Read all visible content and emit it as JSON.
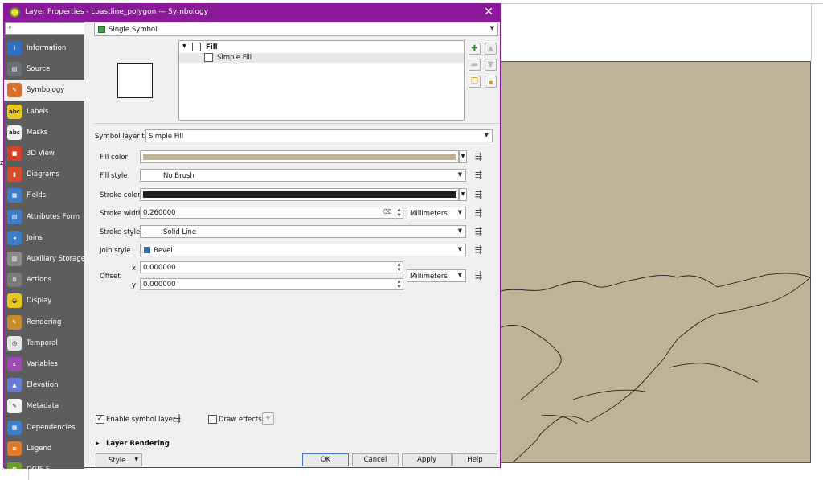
{
  "dialog": {
    "title": "Layer Properties - coastline_polygon — Symbology"
  },
  "sidebar": {
    "search_placeholder": "",
    "items": [
      {
        "label": "Information",
        "icon": "info-icon",
        "color": "#2f6fc2"
      },
      {
        "label": "Source",
        "icon": "source-icon",
        "color": "#6a6f74"
      },
      {
        "label": "Symbology",
        "icon": "paintbrush-icon",
        "color": "#d86f2a"
      },
      {
        "label": "Labels",
        "icon": "labels-icon",
        "color": "#e8c81a"
      },
      {
        "label": "Masks",
        "icon": "masks-icon",
        "color": "#f2f2f2"
      },
      {
        "label": "3D View",
        "icon": "cube-icon",
        "color": "#d8402a"
      },
      {
        "label": "Diagrams",
        "icon": "diagrams-icon",
        "color": "#d84a2a"
      },
      {
        "label": "Fields",
        "icon": "fields-icon",
        "color": "#3d7cc7"
      },
      {
        "label": "Attributes Form",
        "icon": "form-icon",
        "color": "#3d7cc7"
      },
      {
        "label": "Joins",
        "icon": "joins-icon",
        "color": "#3d7cc7"
      },
      {
        "label": "Auxiliary Storage",
        "icon": "storage-icon",
        "color": "#8a8a8a"
      },
      {
        "label": "Actions",
        "icon": "gear-icon",
        "color": "#7a7a7a"
      },
      {
        "label": "Display",
        "icon": "speech-bubble-icon",
        "color": "#e8c81a"
      },
      {
        "label": "Rendering",
        "icon": "brush-icon",
        "color": "#c88a2a"
      },
      {
        "label": "Temporal",
        "icon": "clock-icon",
        "color": "#e5e5e5"
      },
      {
        "label": "Variables",
        "icon": "variables-icon",
        "color": "#9a4ab0"
      },
      {
        "label": "Elevation",
        "icon": "elevation-icon",
        "color": "#6a7ad0"
      },
      {
        "label": "Metadata",
        "icon": "metadata-icon",
        "color": "#f2f2f2"
      },
      {
        "label": "Dependencies",
        "icon": "dependencies-icon",
        "color": "#3d7cc7"
      },
      {
        "label": "Legend",
        "icon": "legend-icon",
        "color": "#e07a2a"
      },
      {
        "label": "QGIS S",
        "icon": "qgis-icon",
        "color": "#6aa02a"
      }
    ]
  },
  "renderer": {
    "value": "Single Symbol"
  },
  "tree": {
    "root": "Fill",
    "child": "Simple Fill"
  },
  "symbol_layer_type": {
    "label": "Symbol layer type",
    "value": "Simple Fill"
  },
  "props": {
    "fill_color_label": "Fill color",
    "fill_color": "#beb297",
    "fill_style_label": "Fill style",
    "fill_style": "No Brush",
    "stroke_color_label": "Stroke color",
    "stroke_color": "#1e1e1e",
    "stroke_width_label": "Stroke width",
    "stroke_width": "0.260000",
    "stroke_width_unit": "Millimeters",
    "stroke_style_label": "Stroke style",
    "stroke_style": "Solid Line",
    "join_style_label": "Join style",
    "join_style": "Bevel",
    "offset_label": "Offset",
    "offset_x_label": "x",
    "offset_x": "0.000000",
    "offset_y_label": "y",
    "offset_y": "0.000000",
    "offset_unit": "Millimeters"
  },
  "footer": {
    "enable_symbol_layer": "Enable symbol layer",
    "draw_effects": "Draw effects",
    "layer_rendering": "Layer Rendering",
    "style": "Style",
    "ok": "OK",
    "cancel": "Cancel",
    "apply": "Apply",
    "help": "Help"
  }
}
